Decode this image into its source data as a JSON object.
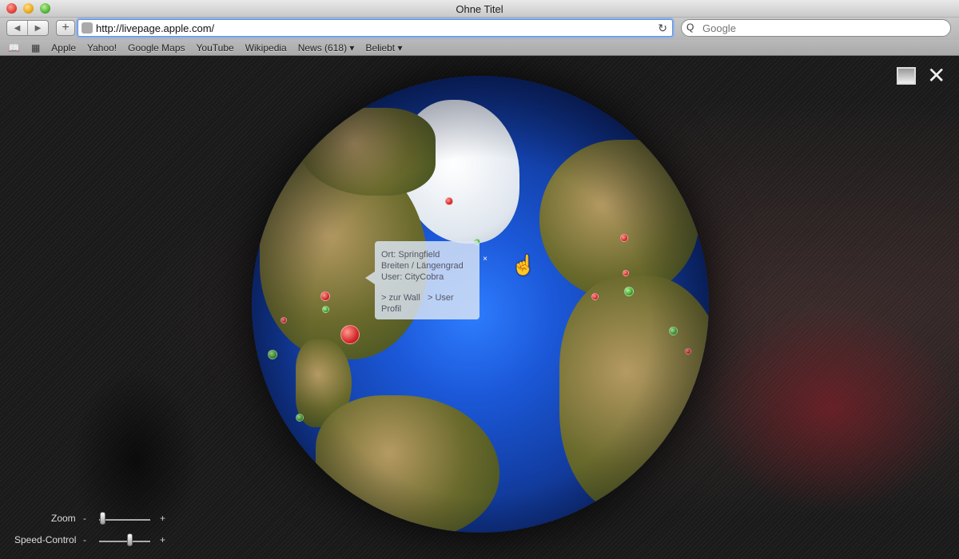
{
  "window": {
    "title": "Ohne Titel"
  },
  "toolbar": {
    "back": "◀",
    "forward": "▶",
    "add": "+",
    "url": "http://livepage.apple.com/",
    "favicon": "",
    "reload": "↻",
    "search_icon": "Q",
    "search_placeholder": "Google"
  },
  "bookmarks": {
    "book_icon": "📖",
    "grid_icon": "▦",
    "items": [
      "Apple",
      "Yahoo!",
      "Google Maps",
      "YouTube",
      "Wikipedia",
      "News (618) ▾",
      "Beliebt ▾"
    ]
  },
  "tooltip": {
    "location": "Ort: Springfield",
    "coords": "Breiten / Längengrad",
    "user": "User: CityCobra",
    "link_wall": "> zur Wall",
    "link_profile": "> User Profil",
    "close": "×"
  },
  "controls": {
    "zoom_label": "Zoom",
    "speed_label": "Speed-Control",
    "minus": "-",
    "plus": "+"
  },
  "icons": {
    "cursor": "☝",
    "close_x": "✕"
  }
}
